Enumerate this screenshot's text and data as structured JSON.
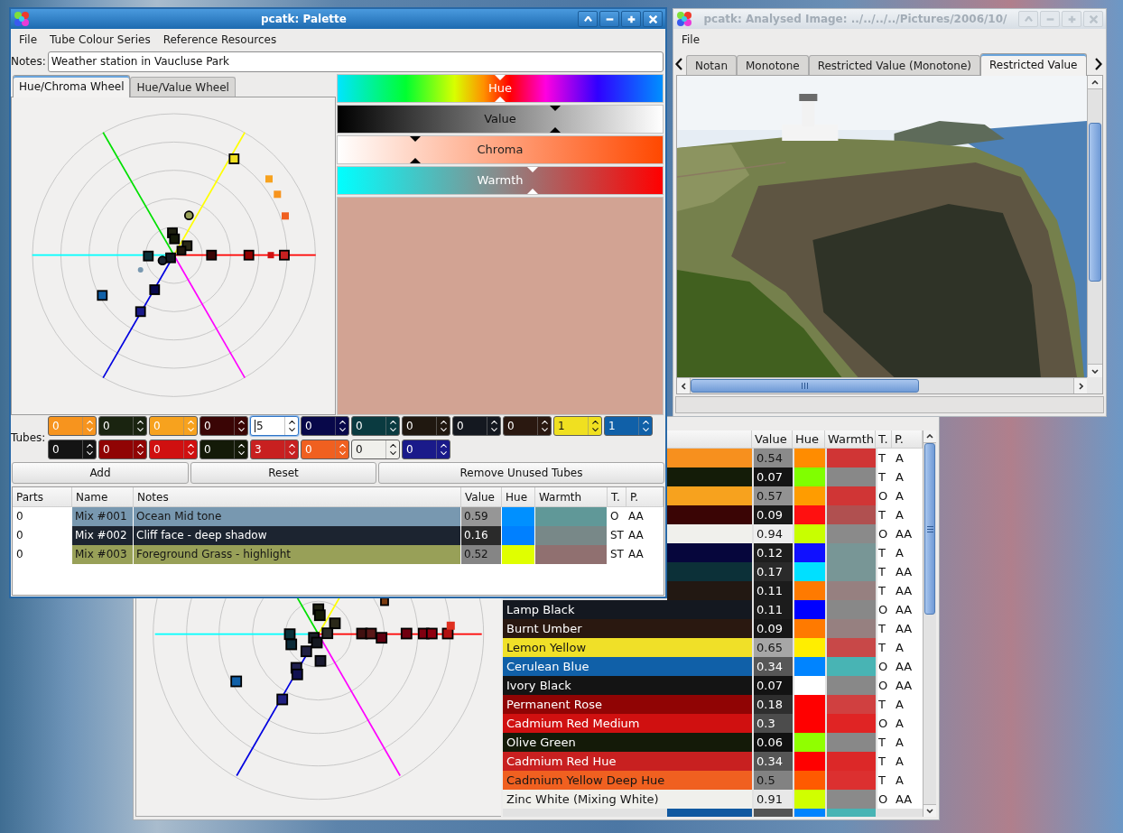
{
  "palette_window": {
    "title": "pcatk: Palette",
    "active": true,
    "menu": [
      "File",
      "Tube Colour Series",
      "Reference Resources"
    ],
    "notes": {
      "label": "Notes:",
      "value": "Weather station in Vaucluse Park"
    },
    "tabs": [
      {
        "label": "Hue/Chroma Wheel",
        "selected": true
      },
      {
        "label": "Hue/Value Wheel",
        "selected": false
      }
    ],
    "attribute_bars": [
      {
        "kind": "hue",
        "label": "Hue",
        "level": 0.5
      },
      {
        "kind": "value",
        "label": "Value",
        "level": 0.67
      },
      {
        "kind": "chroma",
        "label": "Chroma",
        "level": 0.24
      },
      {
        "kind": "warmth",
        "label": "Warmth",
        "level": 0.6
      }
    ],
    "current_colour": {
      "color": "#d2a393"
    },
    "tubes": {
      "label": "Tubes:",
      "spinboxes": [
        {
          "value": "0",
          "color": "#f7941e",
          "focused": false
        },
        {
          "value": "0",
          "color": "#1a2410",
          "focused": false
        },
        {
          "value": "0",
          "color": "#f7a21e",
          "focused": false
        },
        {
          "value": "0",
          "color": "#3a0505",
          "focused": false
        },
        {
          "value": "5",
          "color": "#ffffff",
          "focused": true
        },
        {
          "value": "0",
          "color": "#08084a",
          "focused": false
        },
        {
          "value": "0",
          "color": "#0a3a40",
          "focused": false
        },
        {
          "value": "0",
          "color": "#201810",
          "focused": false
        },
        {
          "value": "0",
          "color": "#141820",
          "focused": false
        },
        {
          "value": "0",
          "color": "#2a1810",
          "focused": false
        },
        {
          "value": "1",
          "color": "#f0e020",
          "focused": false
        },
        {
          "value": "1",
          "color": "#1060a8",
          "focused": false
        },
        {
          "value": "0",
          "color": "#141414",
          "focused": false
        },
        {
          "value": "0",
          "color": "#900404",
          "focused": false
        },
        {
          "value": "0",
          "color": "#d01010",
          "focused": false
        },
        {
          "value": "0",
          "color": "#141a08",
          "focused": false
        },
        {
          "value": "3",
          "color": "#c82020",
          "focused": false
        },
        {
          "value": "0",
          "color": "#f06020",
          "focused": false
        },
        {
          "value": "0",
          "color": "#f0f0ec",
          "focused": false
        },
        {
          "value": "0",
          "color": "#1a1a8a",
          "focused": false
        }
      ]
    },
    "buttons": [
      "Add",
      "Reset",
      "Remove Unused Tubes"
    ],
    "mix_table": {
      "columns": [
        "Parts",
        "Name",
        "Notes",
        "Value",
        "Hue",
        "Warmth",
        "T.",
        "P."
      ],
      "rows": [
        {
          "parts": "0",
          "name": "Mix #001",
          "notes": "Ocean Mid tone",
          "color": "#7898b0",
          "value": {
            "text": "0.59",
            "color": "#969696"
          },
          "hue": {
            "color": "#0090ff"
          },
          "warmth": {
            "color": "#609898"
          },
          "t": "O",
          "p": "AA"
        },
        {
          "parts": "0",
          "name": "Mix #002",
          "notes": "Cliff face - deep shadow",
          "color": "#1c2430",
          "value": {
            "text": "0.16",
            "color": "#2a2a2a"
          },
          "hue": {
            "color": "#0080ff"
          },
          "warmth": {
            "color": "#788888"
          },
          "t": "ST",
          "p": "AA"
        },
        {
          "parts": "0",
          "name": "Mix #003",
          "notes": "Foreground Grass - highlight",
          "color": "#98a058",
          "value": {
            "text": "0.52",
            "color": "#858585"
          },
          "hue": {
            "color": "#e0ff00"
          },
          "warmth": {
            "color": "#907070"
          },
          "t": "ST",
          "p": "AA"
        }
      ]
    }
  },
  "analysed_image_window": {
    "title": "pcatk: Analysed Image: ../../../../Pictures/2006/10/",
    "active": false,
    "menu": [
      "File"
    ],
    "tabs": [
      {
        "label": "Notan",
        "selected": false
      },
      {
        "label": "Monotone",
        "selected": false
      },
      {
        "label": "Restricted Value (Monotone)",
        "selected": false
      },
      {
        "label": "Restricted Value",
        "selected": true
      }
    ]
  },
  "back_window": {
    "columns": [
      "Value",
      "Hue",
      "Warmth",
      "T.",
      "P."
    ],
    "rows": [
      {
        "color": "#f7901e",
        "value": {
          "text": "0.54",
          "color": "#8a8a8a"
        },
        "hue": {
          "color": "#ff8c00"
        },
        "warmth": {
          "color": "#d03535"
        },
        "t": "T",
        "p": "A"
      },
      {
        "color": "#141c08",
        "value": {
          "text": "0.07",
          "color": "#141414"
        },
        "hue": {
          "color": "#80ff00"
        },
        "warmth": {
          "color": "#888888"
        },
        "t": "T",
        "p": "A"
      },
      {
        "color": "#f7a21e",
        "value": {
          "text": "0.57",
          "color": "#929292"
        },
        "hue": {
          "color": "#ff9c00"
        },
        "warmth": {
          "color": "#d03535"
        },
        "t": "O",
        "p": "A"
      },
      {
        "color": "#3a0505",
        "value": {
          "text": "0.09",
          "color": "#1a1a1a"
        },
        "hue": {
          "color": "#ff1010"
        },
        "warmth": {
          "color": "#b05050"
        },
        "t": "T",
        "p": "A"
      },
      {
        "color": "#f0f0ec",
        "value": {
          "text": "0.94",
          "color": "#eeeeee"
        },
        "hue": {
          "color": "#c8ff00"
        },
        "warmth": {
          "color": "#8a8a8a"
        },
        "t": "O",
        "p": "AA"
      },
      {
        "color": "#06063c",
        "value": {
          "text": "0.12",
          "color": "#1e1e1e"
        },
        "hue": {
          "color": "#1010ff"
        },
        "warmth": {
          "color": "#789696"
        },
        "t": "T",
        "p": "A"
      },
      {
        "color": "#0c3038",
        "value": {
          "text": "0.17",
          "color": "#2a2a2a"
        },
        "hue": {
          "color": "#00e0ff"
        },
        "warmth": {
          "color": "#789696"
        },
        "t": "T",
        "p": "AA"
      },
      {
        "color": "#221812",
        "value": {
          "text": "0.11",
          "color": "#1c1c1c"
        },
        "hue": {
          "color": "#ff7a00"
        },
        "warmth": {
          "color": "#968080"
        },
        "t": "T",
        "p": "AA"
      },
      {
        "name": "Lamp Black",
        "color": "#141820",
        "value": {
          "text": "0.11",
          "color": "#1c1c1c"
        },
        "hue": {
          "color": "#0000ff"
        },
        "warmth": {
          "color": "#888888"
        },
        "t": "O",
        "p": "AA"
      },
      {
        "name": "Burnt Umber",
        "color": "#2a1810",
        "value": {
          "text": "0.09",
          "color": "#171717"
        },
        "hue": {
          "color": "#ff7a00"
        },
        "warmth": {
          "color": "#968080"
        },
        "t": "T",
        "p": "AA"
      },
      {
        "name": "Lemon Yellow",
        "color": "#f0e028",
        "value": {
          "text": "0.65",
          "color": "#a6a6a6"
        },
        "hue": {
          "color": "#ffee00"
        },
        "warmth": {
          "color": "#c84848"
        },
        "t": "T",
        "p": "A"
      },
      {
        "name": "Cerulean Blue",
        "color": "#1060a8",
        "value": {
          "text": "0.34",
          "color": "#575757"
        },
        "hue": {
          "color": "#0084ff"
        },
        "warmth": {
          "color": "#48b4b4"
        },
        "t": "O",
        "p": "AA"
      },
      {
        "name": "Ivory Black",
        "color": "#141414",
        "value": {
          "text": "0.07",
          "color": "#131313"
        },
        "hue": {
          "color": "#ffffff"
        },
        "warmth": {
          "color": "#888888"
        },
        "t": "O",
        "p": "AA"
      },
      {
        "name": "Permanent Rose",
        "color": "#900404",
        "value": {
          "text": "0.18",
          "color": "#2e2e2e"
        },
        "hue": {
          "color": "#ff0000"
        },
        "warmth": {
          "color": "#d04040"
        },
        "t": "T",
        "p": "A"
      },
      {
        "name": "Cadmium Red Medium",
        "color": "#d01010",
        "value": {
          "text": "0.3",
          "color": "#4c4c4c"
        },
        "hue": {
          "color": "#ff0000"
        },
        "warmth": {
          "color": "#e02424"
        },
        "t": "O",
        "p": "A"
      },
      {
        "name": "Olive Green",
        "color": "#141a08",
        "value": {
          "text": "0.06",
          "color": "#111111"
        },
        "hue": {
          "color": "#90ff00"
        },
        "warmth": {
          "color": "#888888"
        },
        "t": "T",
        "p": "A"
      },
      {
        "name": "Cadmium Red Hue",
        "color": "#c82020",
        "value": {
          "text": "0.34",
          "color": "#565656"
        },
        "hue": {
          "color": "#ff0000"
        },
        "warmth": {
          "color": "#dc2828"
        },
        "t": "T",
        "p": "A"
      },
      {
        "name": "Cadmium Yellow Deep Hue",
        "color": "#f06020",
        "value": {
          "text": "0.5",
          "color": "#828282"
        },
        "hue": {
          "color": "#ff5a00"
        },
        "warmth": {
          "color": "#dc3030"
        },
        "t": "T",
        "p": "A"
      },
      {
        "name": "Zinc White (Mixing White)",
        "color": "#f0f0ec",
        "value": {
          "text": "0.91",
          "color": "#e8e8e8"
        },
        "hue": {
          "color": "#d0ff00"
        },
        "warmth": {
          "color": "#8a8a8a"
        },
        "t": "O",
        "p": "AA"
      },
      {
        "color": "#1058a0",
        "value": {
          "color": "#555555"
        },
        "hue": {
          "color": "#0084ff"
        },
        "warmth": {
          "color": "#48b4b4"
        }
      }
    ]
  }
}
